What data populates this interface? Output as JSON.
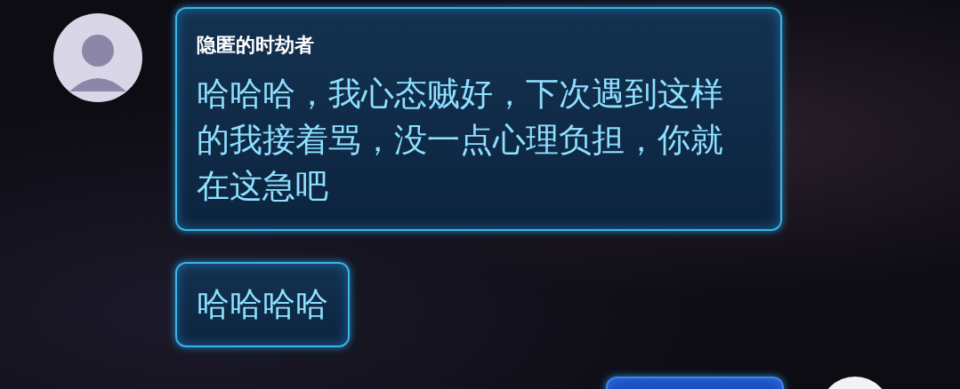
{
  "groups": [
    {
      "sender": "隐匿的时劫者",
      "outgoing": false,
      "messages": [
        {
          "kind": "text",
          "text": "哈哈哈，我心态贼好，下次遇到这样的我接着骂，没一点心理负担，你就在这急吧"
        },
        {
          "kind": "text",
          "text": "哈哈哈哈"
        }
      ]
    },
    {
      "outgoing": true,
      "messages": [
        {
          "kind": "cut_off"
        }
      ]
    }
  ]
}
